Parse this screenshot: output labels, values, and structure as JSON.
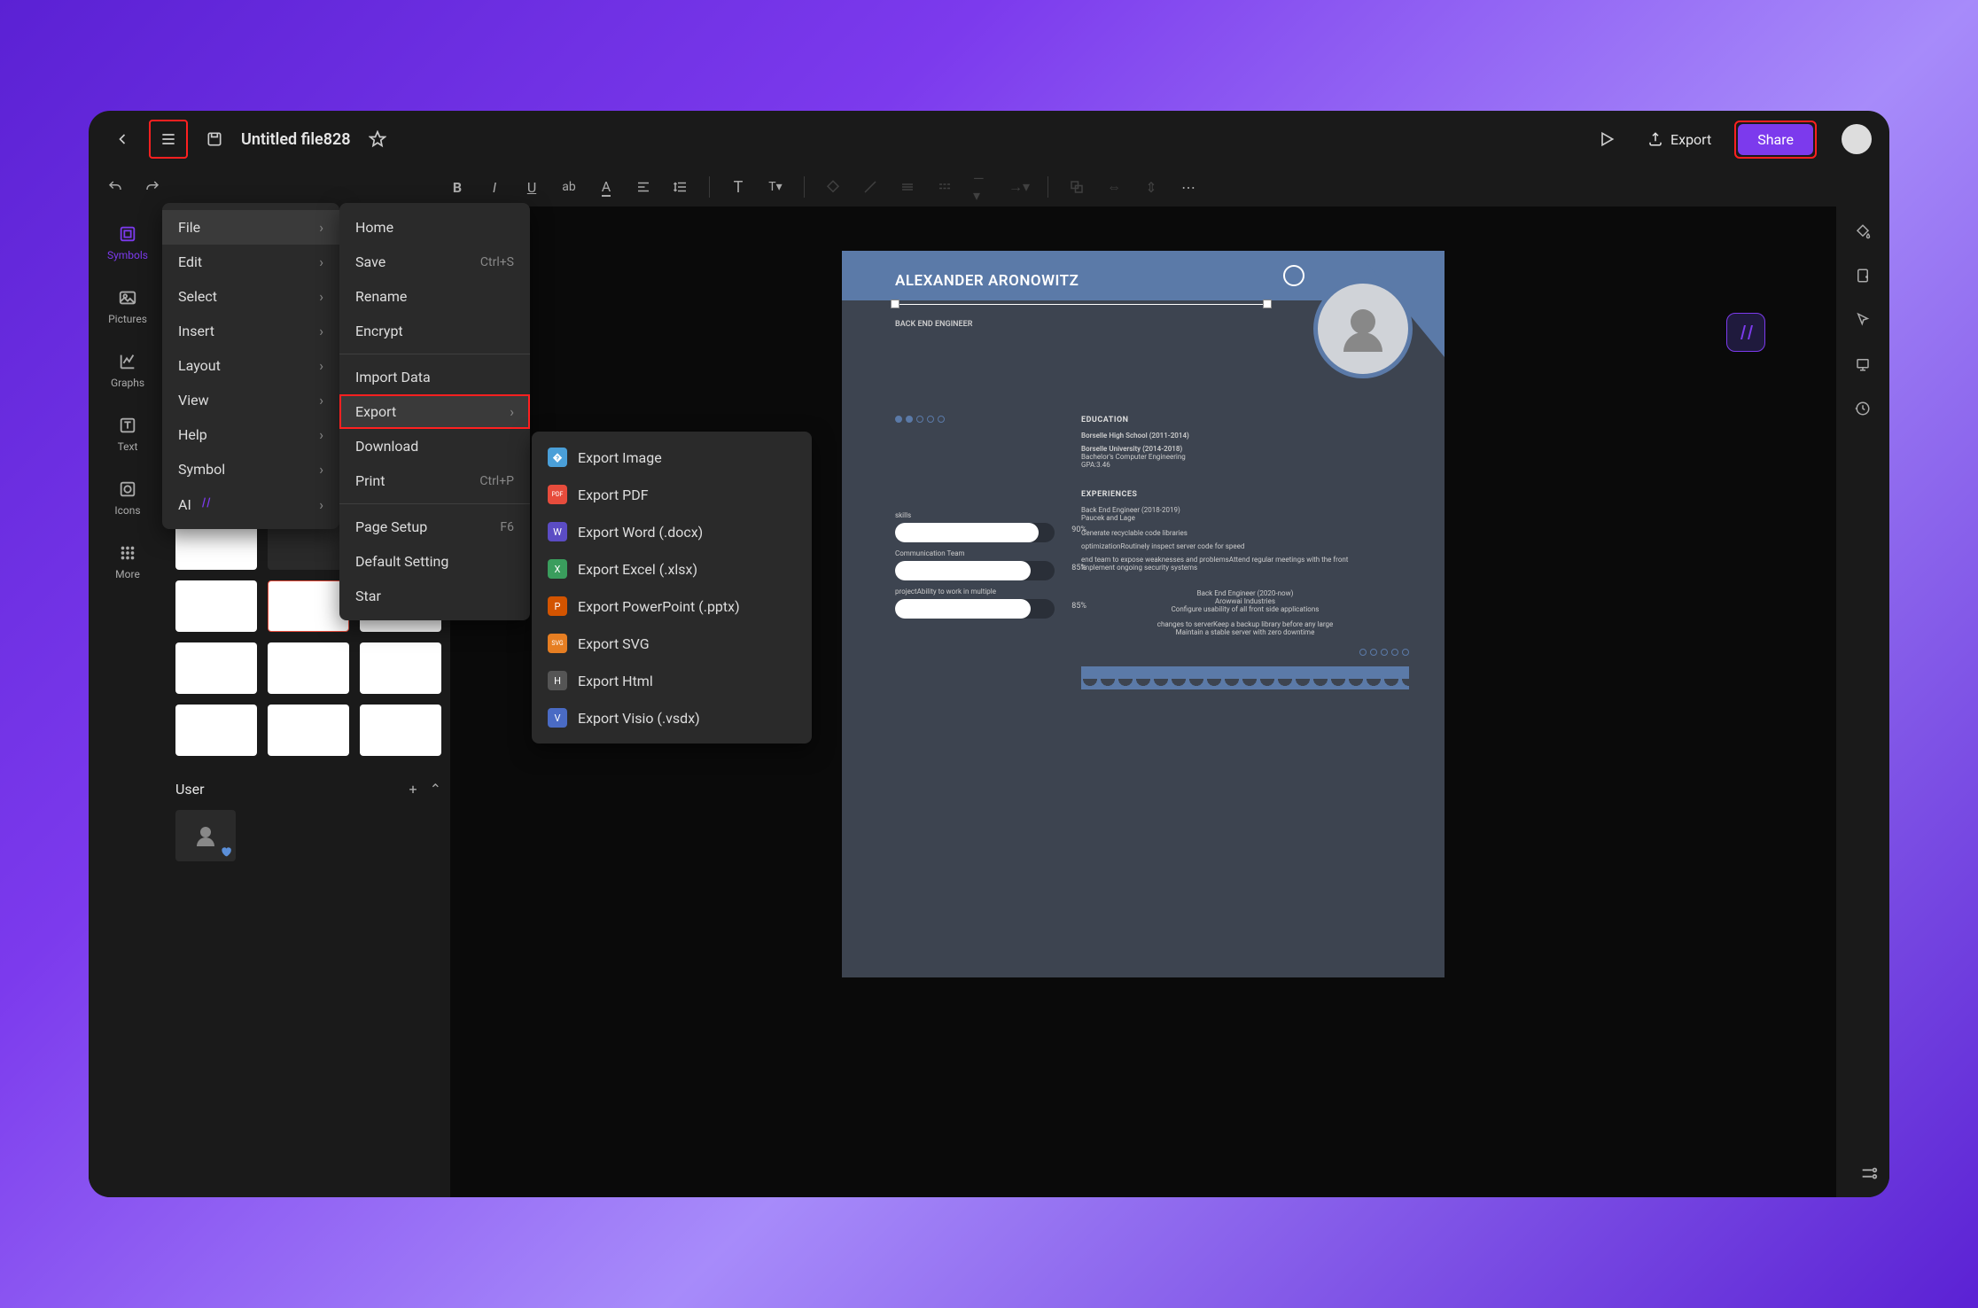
{
  "header": {
    "title": "Untitled file828",
    "export_label": "Export",
    "share_label": "Share"
  },
  "left_rail": {
    "items": [
      {
        "label": "Symbols"
      },
      {
        "label": "Pictures"
      },
      {
        "label": "Graphs"
      },
      {
        "label": "Text"
      },
      {
        "label": "Icons"
      },
      {
        "label": "More"
      }
    ]
  },
  "left_panel": {
    "user_label": "User"
  },
  "menu1": {
    "items": [
      {
        "label": "File",
        "sub": true,
        "hl": true
      },
      {
        "label": "Edit",
        "sub": true
      },
      {
        "label": "Select",
        "sub": true
      },
      {
        "label": "Insert",
        "sub": true
      },
      {
        "label": "Layout",
        "sub": true
      },
      {
        "label": "View",
        "sub": true
      },
      {
        "label": "Help",
        "sub": true
      },
      {
        "label": "Symbol",
        "sub": true
      },
      {
        "label": "AI",
        "sub": true
      }
    ]
  },
  "menu2": {
    "items": [
      {
        "label": "Home"
      },
      {
        "label": "Save",
        "shortcut": "Ctrl+S"
      },
      {
        "label": "Rename"
      },
      {
        "label": "Encrypt"
      },
      {
        "sep": true
      },
      {
        "label": "Import Data"
      },
      {
        "label": "Export",
        "sub": true,
        "hl": true,
        "outline": true
      },
      {
        "label": "Download"
      },
      {
        "label": "Print",
        "shortcut": "Ctrl+P"
      },
      {
        "sep": true
      },
      {
        "label": "Page Setup",
        "shortcut": "F6"
      },
      {
        "label": "Default Setting"
      },
      {
        "label": "Star"
      }
    ]
  },
  "menu3": {
    "items": [
      {
        "label": "Export Image",
        "icon": "img"
      },
      {
        "label": "Export PDF",
        "icon": "pdf"
      },
      {
        "label": "Export Word (.docx)",
        "icon": "word"
      },
      {
        "label": "Export Excel (.xlsx)",
        "icon": "excel"
      },
      {
        "label": "Export PowerPoint (.pptx)",
        "icon": "ppt"
      },
      {
        "label": "Export SVG",
        "icon": "svg"
      },
      {
        "label": "Export Html",
        "icon": "html"
      },
      {
        "label": "Export Visio (.vsdx)",
        "icon": "visio"
      }
    ]
  },
  "resume": {
    "name": "ALEXANDER ARONOWITZ",
    "role": "BACK END ENGINEER",
    "education_title": "EDUCATION",
    "edu1": "Borselle High School (2011-2014)",
    "edu2": "Borselle University (2014-2018)",
    "edu3": "Bachelor's Computer Engineering",
    "edu4": "GPA:3.46",
    "exp_title": "EXPERIENCES",
    "exp1_title": "Back End Engineer (2018-2019)",
    "exp1_company": "Paucek and Lage",
    "exp1_l1": "Generate recyclable code libraries",
    "exp1_l2": "optimizationRoutinely inspect server code for speed",
    "exp1_l3": "end team to expose weaknesses and problemsAttend regular meetings with the front",
    "exp1_l4": "Implement ongoing security systems",
    "exp2_title": "Back End Engineer (2020-now)",
    "exp2_company": "Arowwai Industries",
    "exp2_l1": "Configure usability of all front side applications",
    "exp2_l2": "changes to serverKeep a backup library before any large",
    "exp2_l3": "Maintain a stable server with zero downtime",
    "skills_label": "skills",
    "skill1_label": "Communication Team",
    "skill2_label": "projectAbility to work in multiple",
    "pct1": "90%",
    "pct2": "85%",
    "pct3": "85%"
  }
}
